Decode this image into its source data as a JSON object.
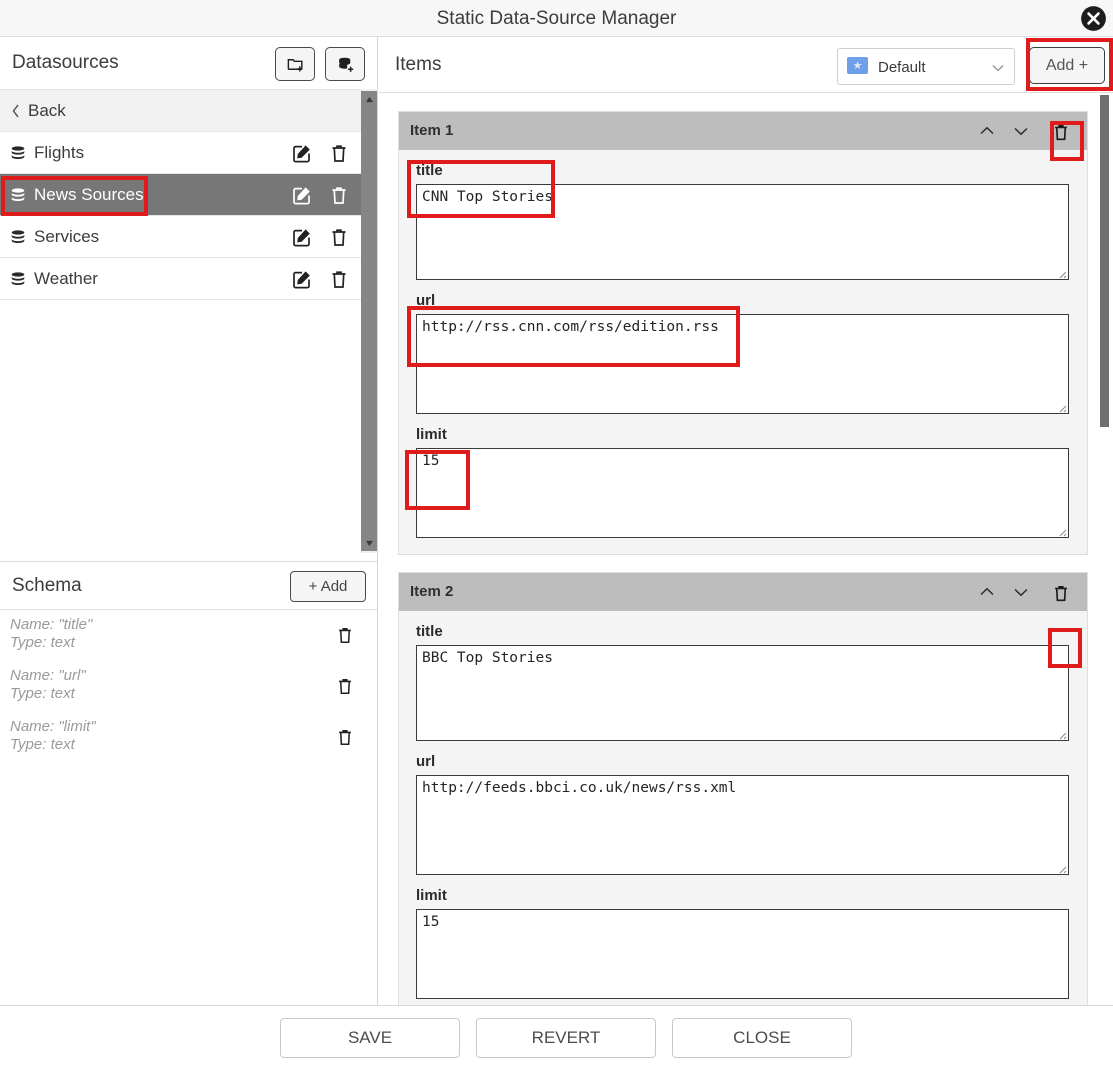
{
  "window": {
    "title": "Static Data-Source Manager",
    "close_icon": "close-circle-icon"
  },
  "sidebar": {
    "header": {
      "title": "Datasources",
      "add_folder_icon": "folder-plus-icon",
      "add_datasource_icon": "database-plus-icon"
    },
    "back_label": "Back",
    "items": [
      {
        "label": "Flights",
        "selected": false
      },
      {
        "label": "News Sources",
        "selected": true
      },
      {
        "label": "Services",
        "selected": false
      },
      {
        "label": "Weather",
        "selected": false
      }
    ],
    "row_icons": {
      "db": "database-icon",
      "edit": "edit-square-icon",
      "delete": "trash-icon"
    },
    "scrollbar": {
      "up_icon": "caret-up-icon",
      "down_icon": "caret-down-icon"
    }
  },
  "schema": {
    "title": "Schema",
    "add_label": "+ Add",
    "fields": [
      {
        "name_line": "Name: \"title\"",
        "type_line": "Type: text"
      },
      {
        "name_line": "Name: \"url\"",
        "type_line": "Type: text"
      },
      {
        "name_line": "Name: \"limit\"",
        "type_line": "Type: text"
      }
    ],
    "delete_icon": "trash-icon"
  },
  "items_panel": {
    "title": "Items",
    "language_select": {
      "value": "Default",
      "flag_icon": "flag-icon",
      "chevron_icon": "chevron-down-icon"
    },
    "add_label": "Add +",
    "items": [
      {
        "name": "Item 1",
        "move_up_icon": "chevron-up-icon",
        "move_down_icon": "chevron-down-icon",
        "delete_icon": "trash-icon",
        "fields": [
          {
            "label": "title",
            "value": "CNN Top Stories"
          },
          {
            "label": "url",
            "value": "http://rss.cnn.com/rss/edition.rss"
          },
          {
            "label": "limit",
            "value": "15"
          }
        ]
      },
      {
        "name": "Item 2",
        "move_up_icon": "chevron-up-icon",
        "move_down_icon": "chevron-down-icon",
        "delete_icon": "trash-icon",
        "fields": [
          {
            "label": "title",
            "value": "BBC Top Stories"
          },
          {
            "label": "url",
            "value": "http://feeds.bbci.co.uk/news/rss.xml"
          },
          {
            "label": "limit",
            "value": "15"
          }
        ]
      }
    ]
  },
  "footer": {
    "save_label": "SAVE",
    "revert_label": "REVERT",
    "close_label": "CLOSE"
  },
  "annotations": {
    "highlight_color": "#e01b1b",
    "boxes": [
      "news-sources-row",
      "add-button",
      "item1-delete",
      "item1-title-field",
      "item1-url-field",
      "item1-limit-field",
      "item2-delete"
    ]
  }
}
